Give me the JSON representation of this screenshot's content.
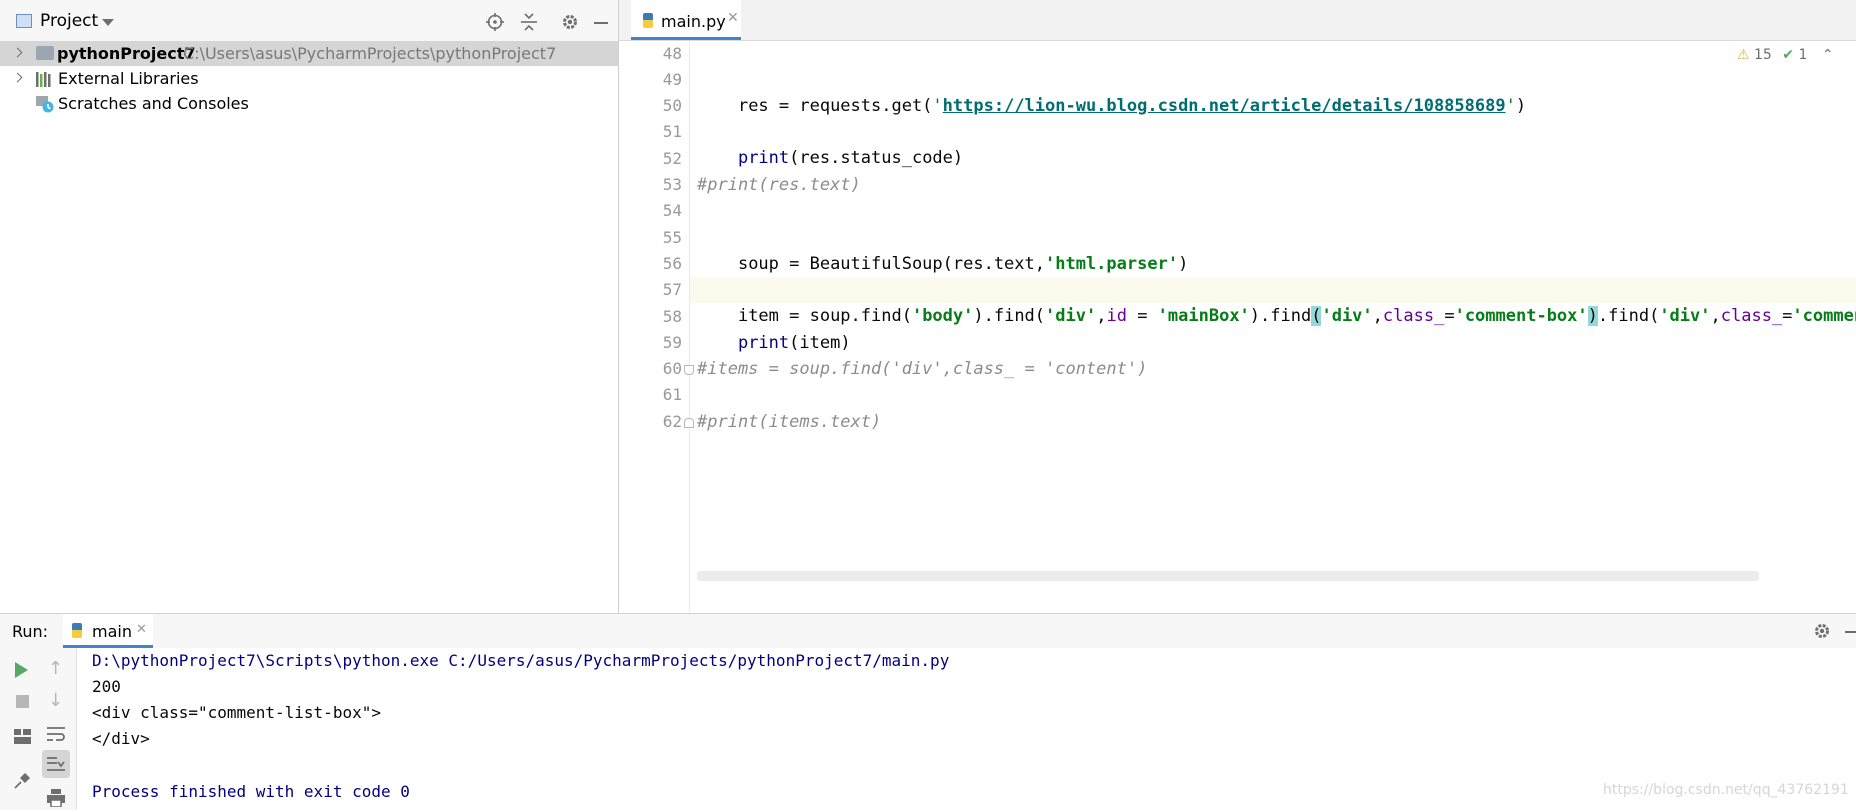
{
  "project_panel": {
    "title": "Project",
    "tree": [
      {
        "name": "pythonProject7",
        "path": "C:\\Users\\asus\\PycharmProjects\\pythonProject7"
      },
      {
        "name": "External Libraries"
      },
      {
        "name": "Scratches and Consoles"
      }
    ]
  },
  "editor": {
    "tab_label": "main.py",
    "inspection": {
      "warnings": "15",
      "ok": "1"
    },
    "line_numbers": [
      "48",
      "49",
      "50",
      "51",
      "52",
      "53",
      "54",
      "55",
      "56",
      "57",
      "58",
      "59",
      "60",
      "61",
      "62"
    ],
    "code": {
      "l49_a": "res = requests.get(",
      "l49_q1": "'",
      "l49_url": "https://lion-wu.blog.csdn.net/article/details/108858689",
      "l49_q2": "'",
      "l49_b": ")",
      "l51_a": "print",
      "l51_b": "(res.status_code)",
      "l53": "#print(res.text)",
      "l55_a": "soup = BeautifulSoup(res.text,",
      "l55_s": "'html.parser'",
      "l55_b": ")",
      "l57_a": "item = soup.find(",
      "l57_s1": "'body'",
      "l57_b": ").find(",
      "l57_s2": "'div'",
      "l57_c": ",",
      "l57_k1": "id",
      "l57_d": " = ",
      "l57_s3": "'mainBox'",
      "l57_e": ").find",
      "l57_p1": "(",
      "l57_s4": "'div'",
      "l57_f": ",",
      "l57_k2": "class_",
      "l57_g": "=",
      "l57_s5": "'comment-box'",
      "l57_p2": ")",
      "l57_h": ".find(",
      "l57_s6": "'div'",
      "l57_i": ",",
      "l57_k3": "class_",
      "l57_j": "=",
      "l57_s7": "'comment-list",
      "l58_a": "print",
      "l58_b": "(item)",
      "l60": "#items = soup.find('div',class_ = 'content')",
      "l62": "#print(items.text)"
    }
  },
  "run_panel": {
    "label": "Run:",
    "tab_label": "main",
    "output": [
      "D:\\pythonProject7\\Scripts\\python.exe C:/Users/asus/PycharmProjects/pythonProject7/main.py",
      "200",
      "<div class=\"comment-list-box\">",
      "</div>",
      "",
      "Process finished with exit code 0"
    ],
    "watermark": "https://blog.csdn.net/qq_43762191"
  },
  "colors": {
    "string": "#067d17",
    "url": "#006d70",
    "builtin": "#000080",
    "keyword_arg": "#660099",
    "comment": "#8c8c8c",
    "console_blue": "#000080"
  }
}
